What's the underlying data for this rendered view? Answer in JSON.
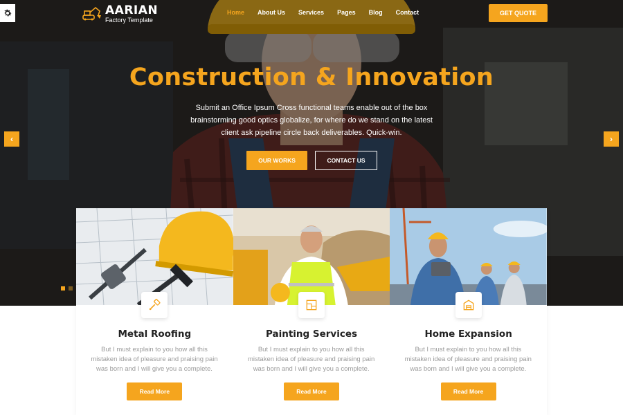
{
  "brand": {
    "name": "AARIAN",
    "tagline": "Factory Template",
    "logo_icon": "excavator-icon"
  },
  "nav": {
    "items": [
      {
        "label": "Home",
        "active": true
      },
      {
        "label": "About Us",
        "active": false
      },
      {
        "label": "Services",
        "active": false
      },
      {
        "label": "Pages",
        "active": false
      },
      {
        "label": "Blog",
        "active": false
      },
      {
        "label": "Contact",
        "active": false
      }
    ],
    "cta_label": "GET QUOTE"
  },
  "hero": {
    "title": "Construction & Innovation",
    "description": "Submit an Office Ipsum Cross functional teams enable out of the box brainstorming good optics globalize, for where do we stand on the latest client ask pipeline circle back deliverables. Quick-win.",
    "primary_button": "OUR WORKS",
    "secondary_button": "CONTACT US",
    "prev_icon": "chevron-left-icon",
    "next_icon": "chevron-right-icon",
    "slide_count": 2,
    "active_slide": 1
  },
  "services": [
    {
      "title": "Metal Roofing",
      "text": "But I must explain to you how all this mistaken idea of pleasure and praising pain was born and I will give you a complete.",
      "button": "Read More",
      "icon": "roller-brush-icon"
    },
    {
      "title": "Painting Services",
      "text": "But I must explain to you how all this mistaken idea of pleasure and praising pain was born and I will give you a complete.",
      "button": "Read More",
      "icon": "blueprint-icon"
    },
    {
      "title": "Home Expansion",
      "text": "But I must explain to you how all this mistaken idea of pleasure and praising pain was born and I will give you a complete.",
      "button": "Read More",
      "icon": "building-icon"
    }
  ],
  "colors": {
    "accent": "#f5a51e",
    "title_text": "#222222",
    "muted_text": "#9a9a9a"
  },
  "settings_icon": "gear-icon"
}
